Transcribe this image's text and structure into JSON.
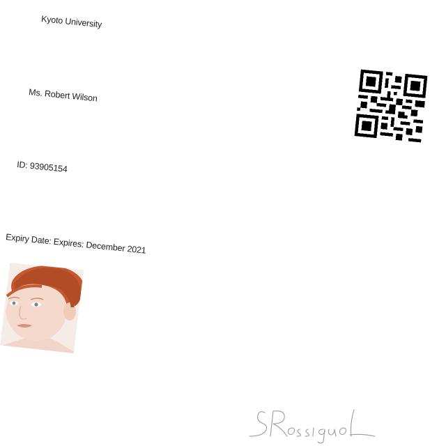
{
  "card": {
    "university": "Kyoto University",
    "name": "Ms. Robert Wilson",
    "id": "ID: 93905154",
    "expiry": "Expiry Date: Expires: December 2021",
    "signature_text": "S.Rossignol"
  },
  "colors": {
    "text": "#1e1e1e",
    "hair": "#c85a32",
    "skin": "#f4d6c8",
    "qr": "#000000",
    "signature_ink": "#9a9a9a"
  },
  "icons": {
    "qr": "qr-code-icon"
  }
}
